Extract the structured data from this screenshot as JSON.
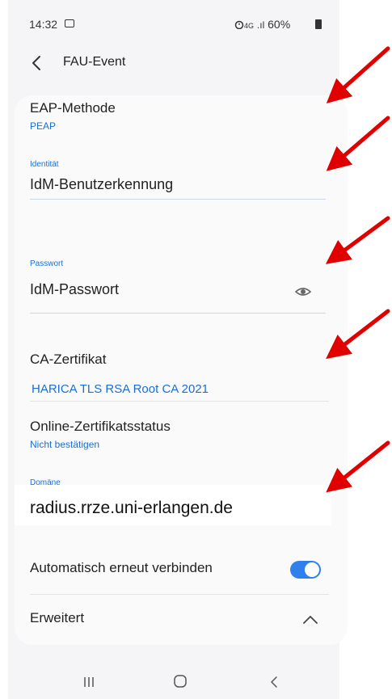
{
  "statusbar": {
    "time": "14:32",
    "network": "4G",
    "battery_text": "60%"
  },
  "topbar": {
    "title": "FAU-Event"
  },
  "form": {
    "eap_label": "EAP-Methode",
    "eap_value": "PEAP",
    "identity_label": "Identität",
    "identity_value": "IdM-Benutzerkennung",
    "password_label": "Passwort",
    "password_value": "IdM-Passwort",
    "ca_label": "CA-Zertifikat",
    "ca_value": "HARICA TLS RSA Root CA 2021",
    "online_label": "Online-Zertifikatsstatus",
    "online_value": "Nicht bestätigen",
    "domain_label": "Domäne",
    "domain_value": "radius.rrze.uni-erlangen.de",
    "auto_reconnect_label": "Automatisch erneut verbinden",
    "auto_reconnect_on": true,
    "advanced_label": "Erweitert"
  },
  "colors": {
    "accent": "#1a6fd6",
    "toggle": "#2f80ed",
    "arrow": "#e00000"
  }
}
